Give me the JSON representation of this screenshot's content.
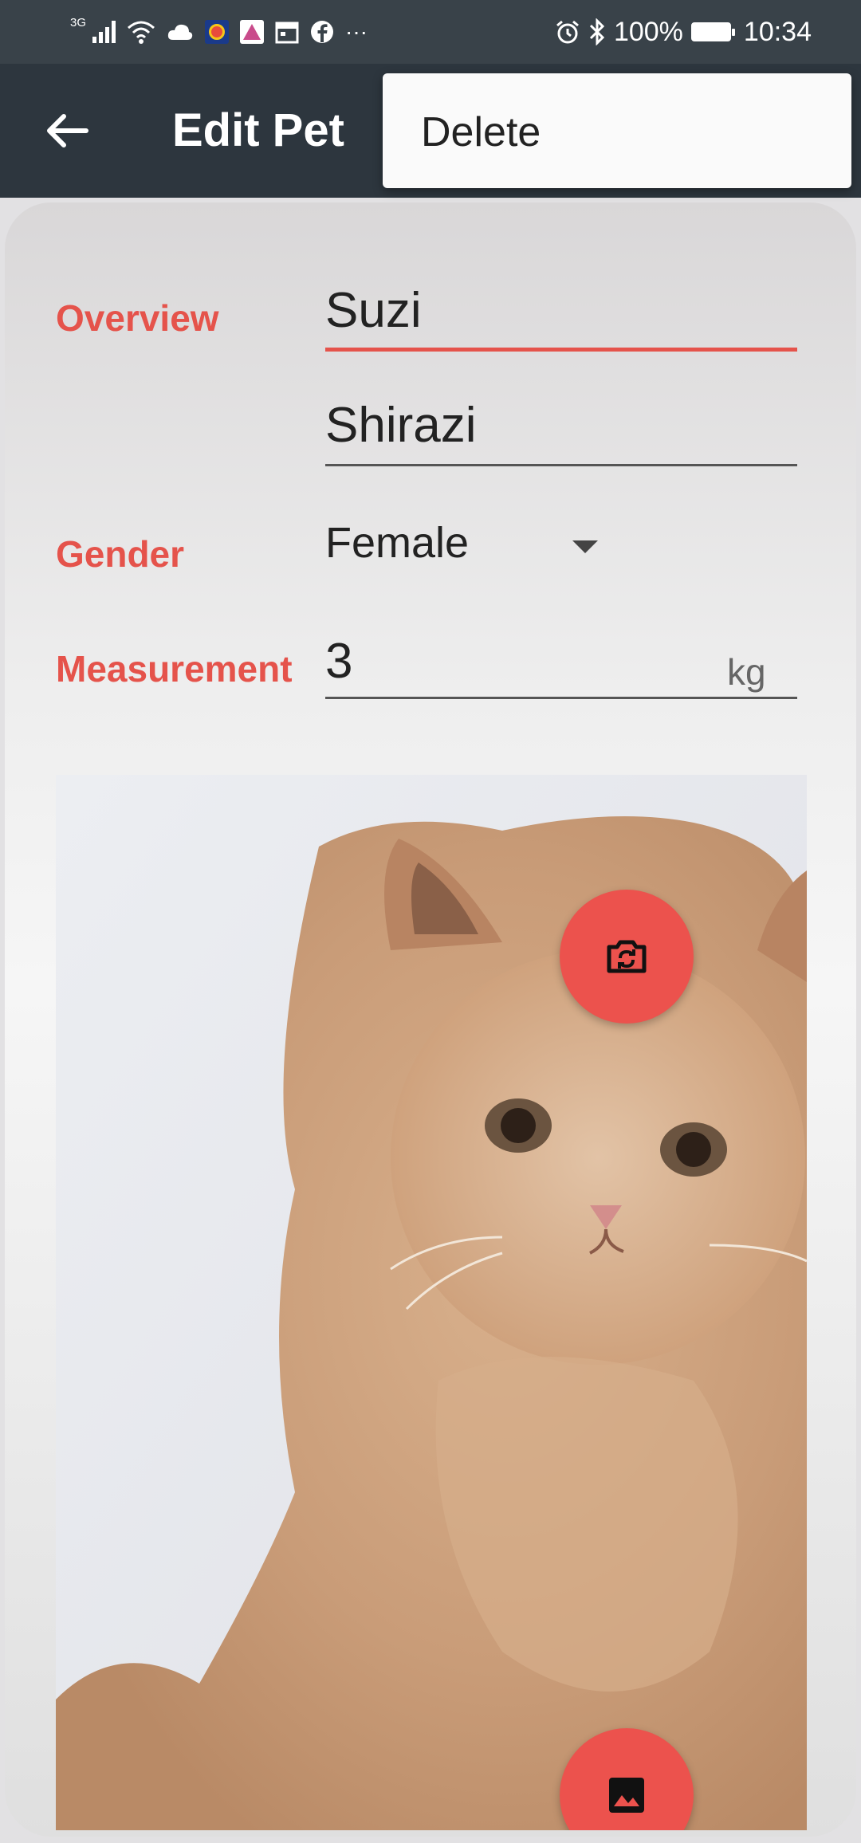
{
  "status_bar": {
    "network": "3G",
    "battery": "100%",
    "time": "10:34",
    "more": "···"
  },
  "app_bar": {
    "title": "Edit Pet",
    "back_icon": "arrow-left-icon"
  },
  "menu": {
    "items": [
      {
        "label": "Delete"
      }
    ]
  },
  "form": {
    "overview_label": "Overview",
    "name_value": "Suzi",
    "breed_value": "Shirazi",
    "gender_label": "Gender",
    "gender_value": "Female",
    "measurement_label": "Measurement",
    "weight_value": "3",
    "weight_unit": "kg"
  },
  "photo": {
    "camera_icon": "switch-camera-icon",
    "gallery_icon": "image-icon"
  },
  "colors": {
    "accent": "#e5534b",
    "app_bar": "#2d363e",
    "status_bar": "#394249"
  }
}
